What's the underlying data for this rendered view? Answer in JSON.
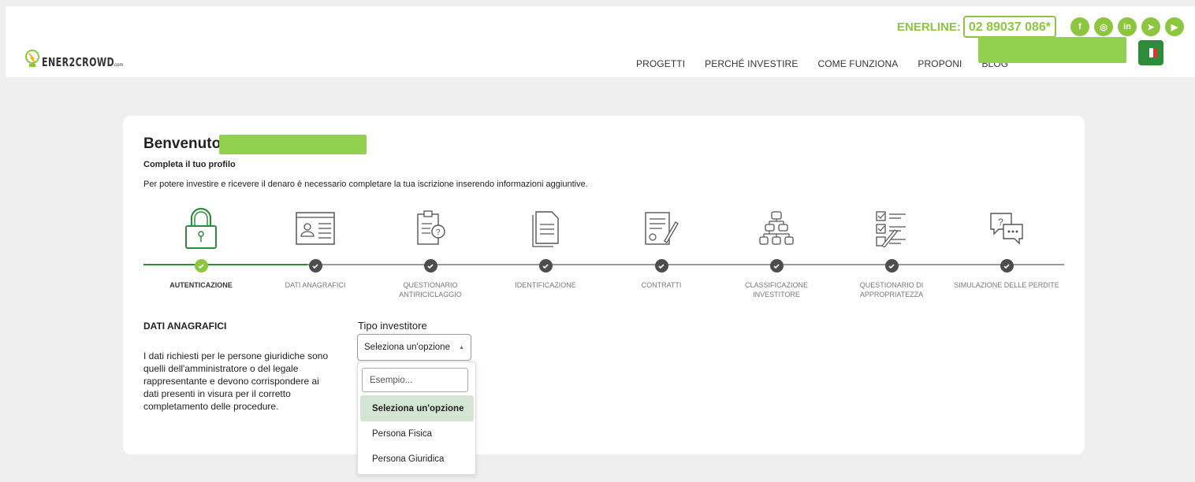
{
  "header": {
    "logo_text": "ENER2CROWD",
    "logo_suffix": ".com",
    "enerline_label": "ENERLINE:",
    "enerline_number": "02 89037 086*",
    "socials": [
      "facebook-icon",
      "instagram-icon",
      "linkedin-icon",
      "telegram-icon",
      "youtube-icon"
    ],
    "nav": [
      "PROGETTI",
      "PERCHÉ INVESTIRE",
      "COME FUNZIONA",
      "PROPONI",
      "BLOG"
    ],
    "language": "it"
  },
  "card": {
    "welcome": "Benvenuto",
    "subtitle": "Completa il tuo profilo",
    "description": "Per potere investire e ricevere il denaro è necessario completare la tua iscrizione inserendo informazioni aggiuntive.",
    "steps": [
      {
        "label": "AUTENTICAZIONE",
        "icon": "lock-icon",
        "done": true,
        "active": true
      },
      {
        "label": "DATI ANAGRAFICI",
        "icon": "id-card-icon",
        "done": false
      },
      {
        "label": "QUESTIONARIO ANTIRICICLAGGIO",
        "icon": "clipboard-question-icon",
        "done": false
      },
      {
        "label": "IDENTIFICAZIONE",
        "icon": "documents-icon",
        "done": false
      },
      {
        "label": "CONTRATTI",
        "icon": "contract-sign-icon",
        "done": false
      },
      {
        "label": "CLASSIFICAZIONE INVESTITORE",
        "icon": "hierarchy-icon",
        "done": false
      },
      {
        "label": "QUESTIONARIO DI APPROPRIATEZZA",
        "icon": "checklist-icon",
        "done": false
      },
      {
        "label": "SIMULAZIONE DELLE PERDITE",
        "icon": "chat-bubbles-icon",
        "done": false
      }
    ],
    "section_title": "DATI ANAGRAFICI",
    "section_text": "I dati richiesti per le persone giuridiche sono quelli dell'amministratore o del legale rappresentante e devono corrispondere ai dati presenti in visura per il corretto completamento delle procedure.",
    "field_label": "Tipo investitore",
    "select_value": "Seleziona un'opzione"
  },
  "dropdown": {
    "search_placeholder": "Esempio...",
    "options": [
      "Seleziona un'opzione",
      "Persona Fisica",
      "Persona Giuridica"
    ],
    "selected_index": 0
  },
  "colors": {
    "brand_green": "#8cc63f",
    "dark_green": "#2e8b3a",
    "redaction": "#92d050"
  }
}
